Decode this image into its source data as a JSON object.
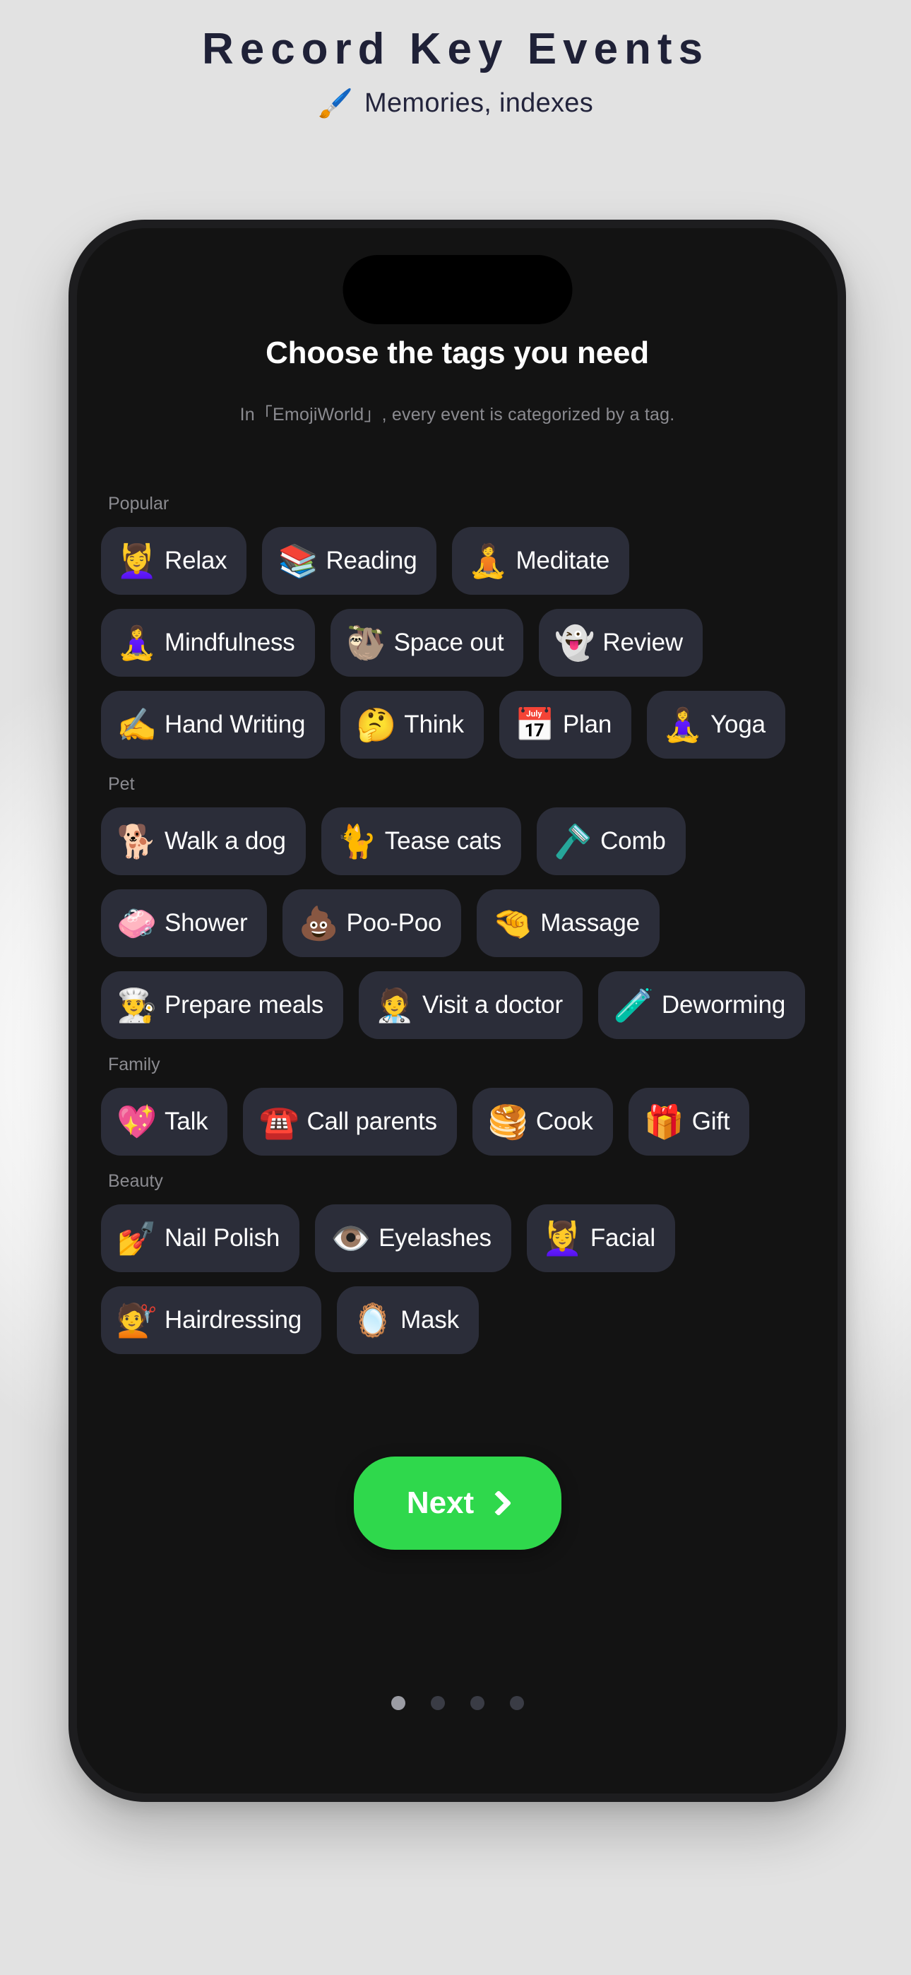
{
  "promo": {
    "title": "Record Key Events",
    "subtitle": "Memories, indexes",
    "subtitle_emoji": "🖌️",
    "title_color": "#1f2137"
  },
  "screen": {
    "title": "Choose the tags you need",
    "description": "In「EmojiWorld」, every event is categorized by a tag."
  },
  "groups": [
    {
      "label": "Popular",
      "tags": [
        {
          "emoji": "💆‍♀️",
          "label": "Relax",
          "icon": "relax-emoji"
        },
        {
          "emoji": "📚",
          "label": "Reading",
          "icon": "books-emoji"
        },
        {
          "emoji": "🧘",
          "label": "Meditate",
          "icon": "meditate-emoji"
        },
        {
          "emoji": "🧘‍♀️",
          "label": "Mindfulness",
          "icon": "mindfulness-emoji"
        },
        {
          "emoji": "🦥",
          "label": "Space out",
          "icon": "sloth-emoji"
        },
        {
          "emoji": "👻",
          "label": "Review",
          "icon": "ghost-emoji"
        },
        {
          "emoji": "✍️",
          "label": "Hand Writing",
          "icon": "writing-hand-emoji"
        },
        {
          "emoji": "🤔",
          "label": "Think",
          "icon": "thinking-face-emoji"
        },
        {
          "emoji": "📅",
          "label": "Plan",
          "icon": "calendar-emoji"
        },
        {
          "emoji": "🧘‍♀️",
          "label": "Yoga",
          "icon": "yoga-emoji"
        }
      ]
    },
    {
      "label": "Pet",
      "tags": [
        {
          "emoji": "🐕",
          "label": "Walk a dog",
          "icon": "dog-emoji"
        },
        {
          "emoji": "🐈",
          "label": "Tease cats",
          "icon": "cat-emoji"
        },
        {
          "emoji": "🪒",
          "label": "Comb",
          "icon": "razor-emoji"
        },
        {
          "emoji": "🧼",
          "label": "Shower",
          "icon": "soap-emoji"
        },
        {
          "emoji": "💩",
          "label": "Poo-Poo",
          "icon": "poop-emoji"
        },
        {
          "emoji": "🤏",
          "label": "Massage",
          "icon": "pinching-hand-emoji"
        },
        {
          "emoji": "👨‍🍳",
          "label": "Prepare meals",
          "icon": "chef-emoji"
        },
        {
          "emoji": "🧑‍⚕️",
          "label": "Visit a doctor",
          "icon": "doctor-emoji"
        },
        {
          "emoji": "🧪",
          "label": "Deworming",
          "icon": "test-tube-emoji"
        }
      ]
    },
    {
      "label": "Family",
      "tags": [
        {
          "emoji": "💖",
          "label": "Talk",
          "icon": "sparkling-heart-emoji"
        },
        {
          "emoji": "☎️",
          "label": "Call parents",
          "icon": "telephone-emoji"
        },
        {
          "emoji": "🥞",
          "label": "Cook",
          "icon": "pancakes-emoji"
        },
        {
          "emoji": "🎁",
          "label": "Gift",
          "icon": "gift-emoji"
        }
      ]
    },
    {
      "label": "Beauty",
      "tags": [
        {
          "emoji": "💅",
          "label": "Nail Polish",
          "icon": "nail-polish-emoji"
        },
        {
          "emoji": "👁️",
          "label": "Eyelashes",
          "icon": "eyelashes-emoji"
        },
        {
          "emoji": "💆‍♀️",
          "label": "Facial",
          "icon": "facial-emoji"
        },
        {
          "emoji": "💇",
          "label": "Hairdressing",
          "icon": "haircut-emoji"
        },
        {
          "emoji": "🪞",
          "label": "Mask",
          "icon": "mask-emoji"
        }
      ]
    }
  ],
  "cta": {
    "label": "Next",
    "color": "#2fd84c"
  },
  "pagination": {
    "total": 4,
    "active_index": 0
  }
}
